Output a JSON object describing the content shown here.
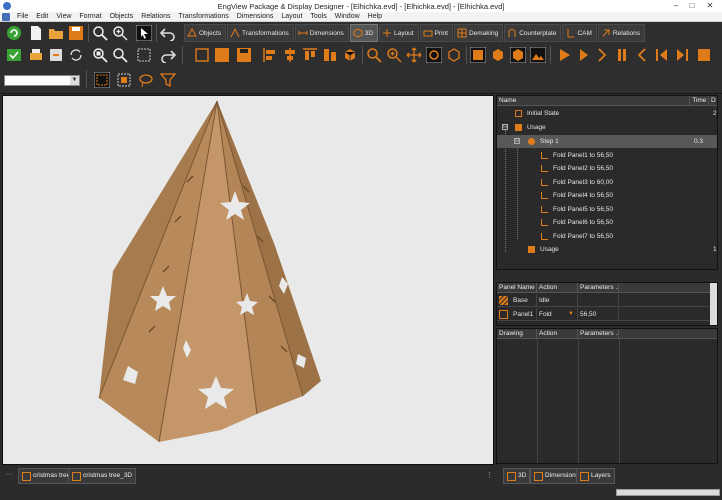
{
  "window": {
    "title": "EngView Package & Display Designer - [Elhichka.evd] - [Elhichka.evd] - [Elhichka.evd]"
  },
  "menu": [
    "File",
    "Edit",
    "View",
    "Format",
    "Objects",
    "Relations",
    "Transformations",
    "Dimensions",
    "Layout",
    "Tools",
    "Window",
    "Help"
  ],
  "mode_tabs": [
    "Objects",
    "Transformations",
    "Dimensions",
    "3D",
    "Layout",
    "Print",
    "Demaking",
    "Counterplate",
    "CAM",
    "Relations"
  ],
  "active_mode_tab": "3D",
  "colors": {
    "accent": "#e07b1a",
    "model": "#b5895a",
    "viewport_bg": "#e9e9e9"
  },
  "animation_tree": {
    "columns": [
      "Name",
      "Time",
      "D"
    ],
    "rows": [
      {
        "label": "Initial State",
        "time": "",
        "d": "2",
        "level": 1,
        "icon": "square-outline-icon"
      },
      {
        "label": "Usage",
        "time": "",
        "d": "",
        "level": 1,
        "icon": "square-filled-icon",
        "expander": "⊟"
      },
      {
        "label": "Step 1",
        "time": "0.3",
        "d": "",
        "level": 2,
        "icon": "step-icon",
        "expander": "⊟",
        "selected": true
      },
      {
        "label": "Fold Panel1 to 56,50",
        "time": "",
        "d": "",
        "level": 3,
        "icon": "fold-icon"
      },
      {
        "label": "Fold Panel2 to 56,50",
        "time": "",
        "d": "",
        "level": 3,
        "icon": "fold-icon"
      },
      {
        "label": "Fold Panel3 to 60,00",
        "time": "",
        "d": "",
        "level": 3,
        "icon": "fold-icon"
      },
      {
        "label": "Fold Panel4 to 56,50",
        "time": "",
        "d": "",
        "level": 3,
        "icon": "fold-icon"
      },
      {
        "label": "Fold Panel5 to 56,50",
        "time": "",
        "d": "",
        "level": 3,
        "icon": "fold-icon"
      },
      {
        "label": "Fold Panel6 to 56,50",
        "time": "",
        "d": "",
        "level": 3,
        "icon": "fold-icon"
      },
      {
        "label": "Fold Panel7 to 56,50",
        "time": "",
        "d": "",
        "level": 3,
        "icon": "fold-icon"
      },
      {
        "label": "Usage",
        "time": "",
        "d": "1",
        "level": 2,
        "icon": "square-filled-icon"
      }
    ]
  },
  "panel_grid": {
    "columns": [
      "Panel Name",
      "Action",
      "Parameters ..."
    ],
    "rows": [
      {
        "name": "Base",
        "action": "Idle",
        "params": ""
      },
      {
        "name": "Panel1",
        "action": "Fold",
        "params": "56,50"
      }
    ]
  },
  "drawing_grid": {
    "columns": [
      "Drawing",
      "Action",
      "Parameters ..."
    ]
  },
  "bottom_tabs": [
    "cristmas tree",
    "cristmas tree_3D"
  ],
  "panel_tabs": [
    "3D",
    "Dimensions",
    "Layers"
  ]
}
